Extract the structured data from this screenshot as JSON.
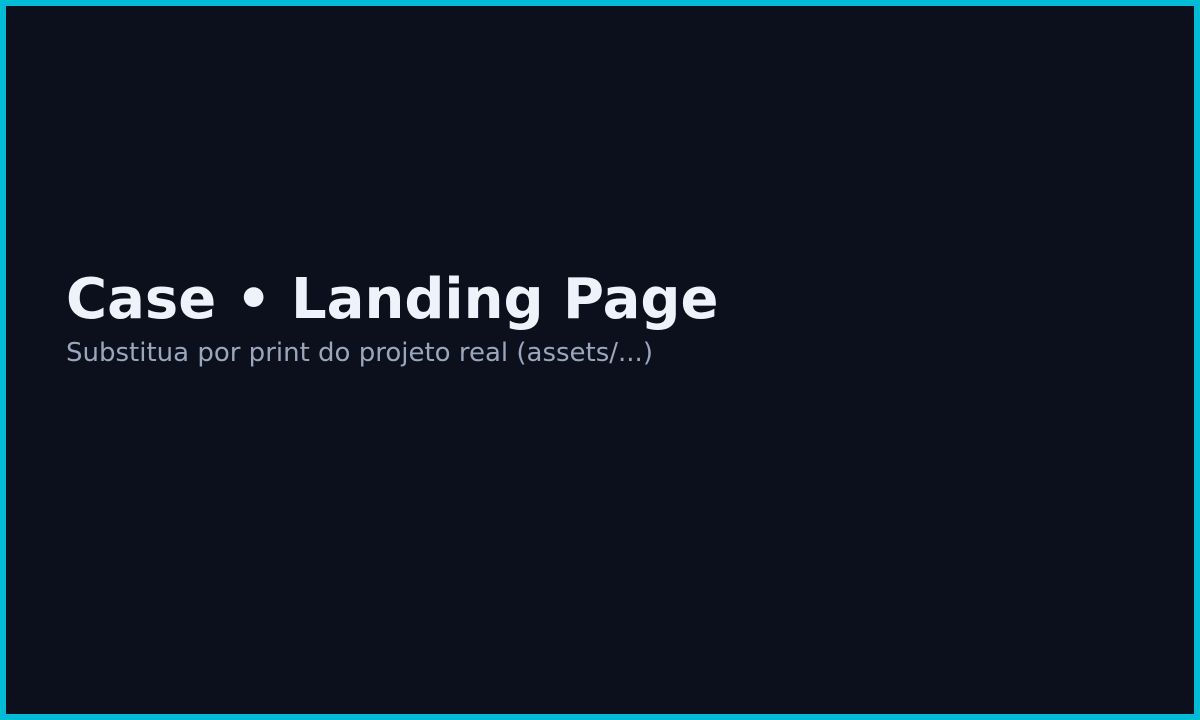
{
  "placeholder": {
    "title": "Case • Landing Page",
    "subtitle": "Substitua por print do projeto real (assets/...)"
  },
  "colors": {
    "border": "#00bcd4",
    "background": "#0b101c",
    "title_text": "#eef2fa",
    "subtitle_text": "#9aa6bb"
  }
}
